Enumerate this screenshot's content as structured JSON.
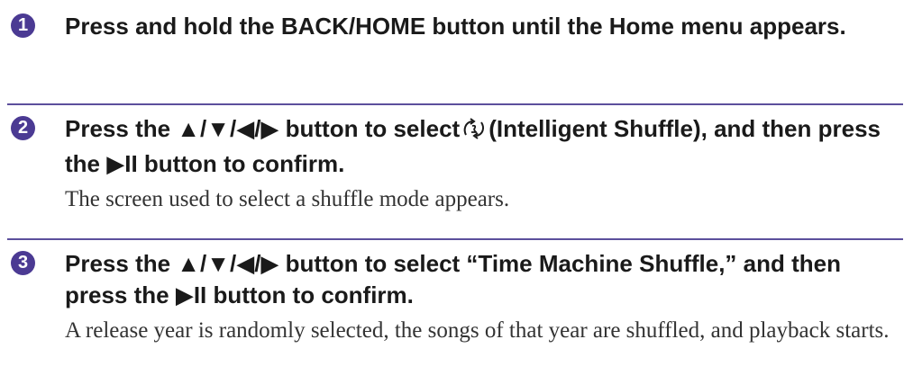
{
  "steps": [
    {
      "number": "1",
      "instruction": "Press and hold the BACK/HOME button until the Home menu appears."
    },
    {
      "number": "2",
      "instruction_part1": "Press the ▲/▼/◀/▶ button to select",
      "icon": "intelligent-shuffle-icon",
      "instruction_part2": "(Intelligent Shuffle), and then press the ▶II button to confirm.",
      "result": "The screen used to select a shuffle mode appears."
    },
    {
      "number": "3",
      "instruction": "Press the ▲/▼/◀/▶ button to select “Time Machine Shuffle,” and then press the ▶II button to confirm.",
      "result": "A release year is randomly selected, the songs of that year are shuffled, and playback starts."
    }
  ],
  "colors": {
    "accent": "#4b3a93",
    "divider": "#5c4f9c",
    "text": "#1a1a1a"
  }
}
